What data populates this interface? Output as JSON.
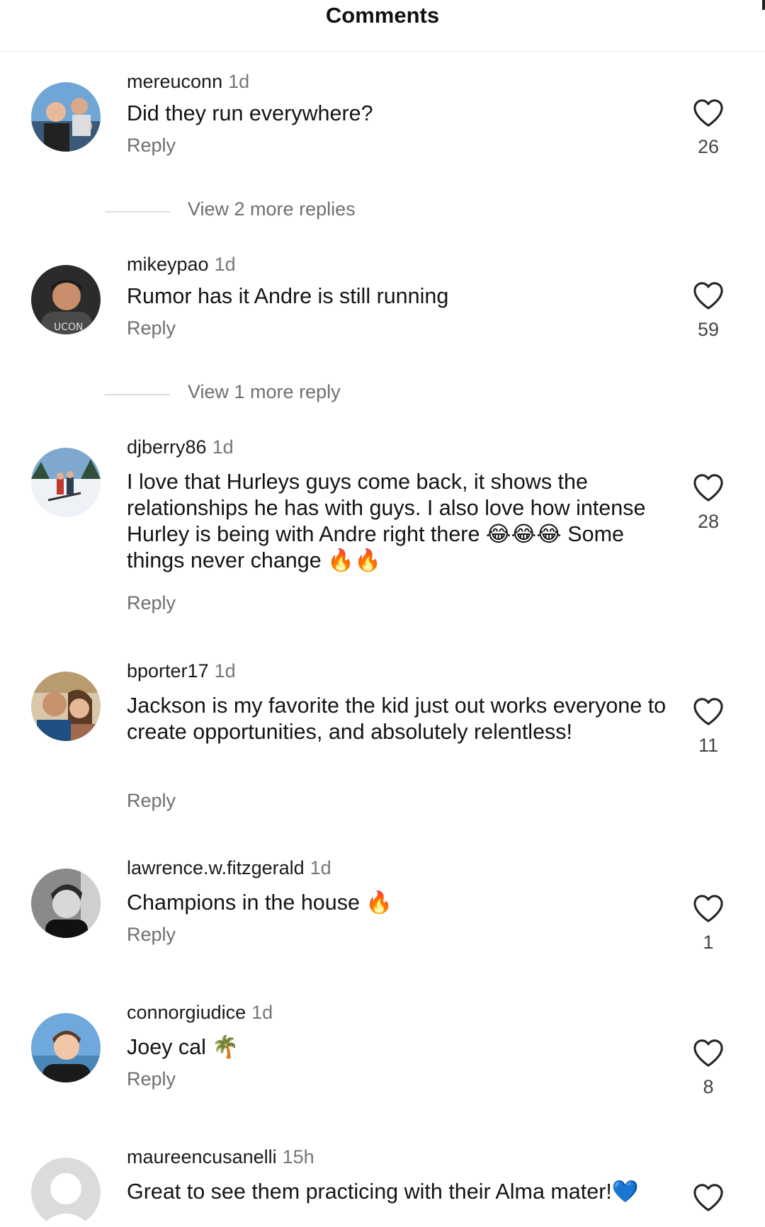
{
  "header": {
    "title": "Comments"
  },
  "labels": {
    "reply": "Reply"
  },
  "comments": [
    {
      "username": "mereuconn",
      "time": "1d",
      "text": "Did they run everywhere?",
      "likes": "26",
      "more_replies": "View 2 more replies",
      "avatar": "group-selfie-avatar"
    },
    {
      "username": "mikeypao",
      "time": "1d",
      "text": "Rumor has it Andre is still running",
      "likes": "59",
      "more_replies": "View 1 more reply",
      "avatar": "man-cap-avatar"
    },
    {
      "username": "djberry86",
      "time": "1d",
      "text": "I love that Hurleys guys come back, it shows the relationships he has with guys. I also love how intense Hurley is being with Andre right there 😂😂😂 Some things never change 🔥🔥",
      "likes": "28",
      "avatar": "ski-slope-avatar"
    },
    {
      "username": "bporter17",
      "time": "1d",
      "text": "Jackson is my favorite the kid just out works everyone to create opportunities, and absolutely relentless!",
      "likes": "11",
      "avatar": "couple-selfie-avatar"
    },
    {
      "username": "lawrence.w.fitzgerald",
      "time": "1d",
      "text": "Champions in the house 🔥",
      "likes": "1",
      "avatar": "bw-portrait-avatar"
    },
    {
      "username": "connorgiudice",
      "time": "1d",
      "text": "Joey cal 🌴",
      "likes": "8",
      "avatar": "young-man-avatar"
    },
    {
      "username": "maureencusanelli",
      "time": "15h",
      "text": "Great to see them practicing with their Alma mater!💙",
      "avatar": "default-avatar"
    }
  ],
  "colors": {
    "background": "#ffffff",
    "username": "#1a1a1a",
    "muted": "#6f6f6f",
    "divider": "#ececec"
  }
}
